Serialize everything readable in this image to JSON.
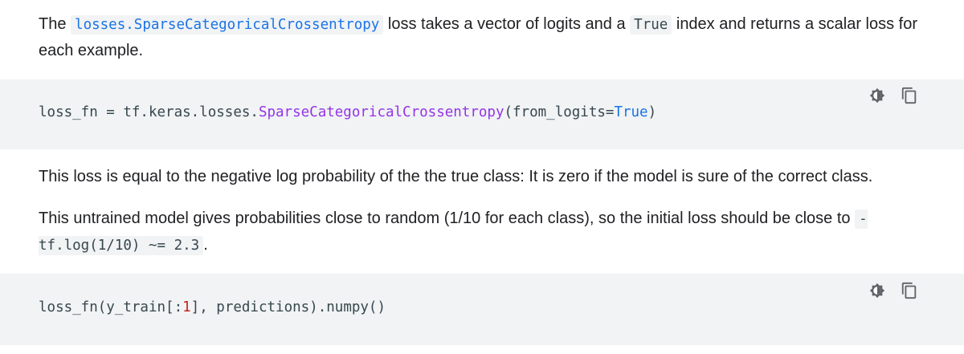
{
  "para1": {
    "t1": "The ",
    "code1": "losses.SparseCategoricalCrossentropy",
    "t2": " loss takes a vector of logits and a ",
    "code2": "True",
    "t3": " index and returns a scalar loss for each example."
  },
  "codeblock1": {
    "prefix": "loss_fn = tf.keras.losses.",
    "cls": "SparseCategoricalCrossentropy",
    "mid": "(from_logits=",
    "kw": "True",
    "suffix": ")",
    "icons": [
      "dark-mode-icon",
      "copy-icon"
    ]
  },
  "para2": {
    "text": "This loss is equal to the negative log probability of the the true class: It is zero if the model is sure of the correct class."
  },
  "para3": {
    "t1": "This untrained model gives probabilities close to random (1/10 for each class), so the initial loss should be close to ",
    "code1": "-tf.log(1/10) ~= 2.3",
    "t2": "."
  },
  "codeblock2": {
    "prefix": "loss_fn(y_train[:",
    "num": "1",
    "suffix": "], predictions).numpy()",
    "icons": [
      "dark-mode-icon",
      "copy-icon"
    ]
  }
}
